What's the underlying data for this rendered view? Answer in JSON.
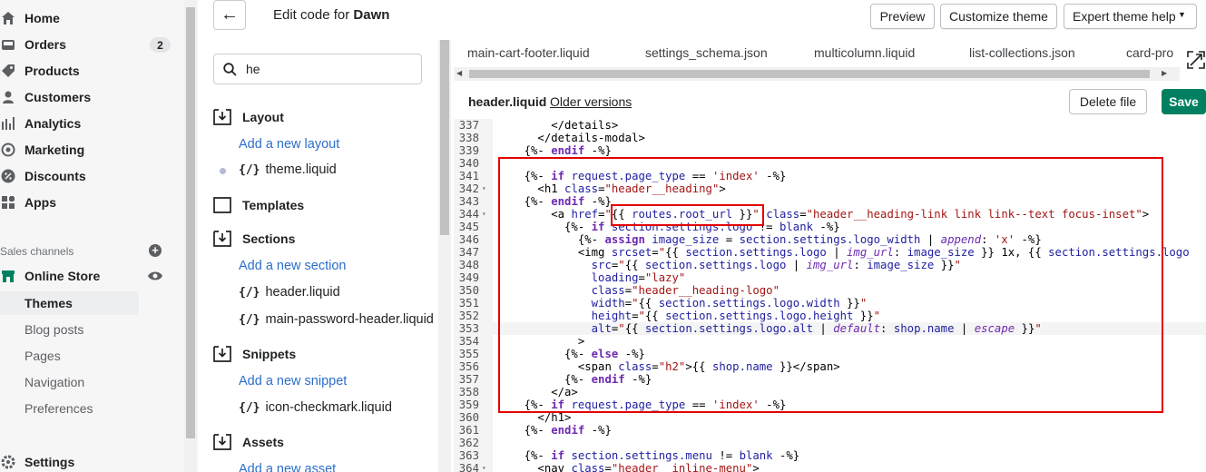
{
  "nav": {
    "items": [
      {
        "label": "Home",
        "icon": "home-icon"
      },
      {
        "label": "Orders",
        "icon": "orders-icon",
        "badge": "2"
      },
      {
        "label": "Products",
        "icon": "tag-icon"
      },
      {
        "label": "Customers",
        "icon": "person-icon"
      },
      {
        "label": "Analytics",
        "icon": "bar-chart-icon"
      },
      {
        "label": "Marketing",
        "icon": "target-icon"
      },
      {
        "label": "Discounts",
        "icon": "discount-icon"
      },
      {
        "label": "Apps",
        "icon": "apps-icon"
      }
    ],
    "sales_channels_label": "Sales channels",
    "online_store_label": "Online Store",
    "sub_items": [
      "Themes",
      "Blog posts",
      "Pages",
      "Navigation",
      "Preferences"
    ],
    "settings_label": "Settings"
  },
  "topbar": {
    "title_prefix": "Edit code for ",
    "theme_name": "Dawn",
    "preview": "Preview",
    "customize": "Customize theme",
    "expert": "Expert theme help"
  },
  "tree": {
    "search_value": "he",
    "layout_label": "Layout",
    "add_layout": "Add a new layout",
    "theme_file": "theme.liquid",
    "templates_label": "Templates",
    "sections_label": "Sections",
    "add_section": "Add a new section",
    "section_files": [
      "header.liquid",
      "main-password-header.liquid"
    ],
    "snippets_label": "Snippets",
    "add_snippet": "Add a new snippet",
    "snippet_file": "icon-checkmark.liquid",
    "assets_label": "Assets",
    "add_asset": "Add a new asset",
    "file_icon_glyph": "{/}"
  },
  "editor": {
    "tabs": [
      "main-cart-footer.liquid",
      "settings_schema.json",
      "multicolumn.liquid",
      "list-collections.json",
      "card-pro"
    ],
    "file_name": "header.liquid",
    "older_versions": "Older versions",
    "delete": "Delete file",
    "save": "Save"
  },
  "code_lines": [
    {
      "n": "337",
      "fold": "",
      "h": "        &lt;/details&gt;"
    },
    {
      "n": "338",
      "fold": "",
      "h": "      &lt;/details-modal&gt;"
    },
    {
      "n": "339",
      "fold": "",
      "h": "    {%- <span class=\"kw\">endif</span> -%}"
    },
    {
      "n": "340",
      "fold": "",
      "h": ""
    },
    {
      "n": "341",
      "fold": "",
      "h": "    {%- <span class=\"kw\">if</span> <span class=\"var\">request.page_type</span> == <span class=\"str\">'index'</span> -%}"
    },
    {
      "n": "342",
      "fold": "▾",
      "h": "      &lt;h1 <span class=\"tag\">class</span>=<span class=\"str\">\"header__heading\"</span>&gt;"
    },
    {
      "n": "343",
      "fold": "",
      "h": "    {%- <span class=\"kw\">endif</span> -%}"
    },
    {
      "n": "344",
      "fold": "▾",
      "h": "        &lt;a <span class=\"tag\">href</span>=<span class=\"str\">\"</span>{{ <span class=\"var\">routes.root_url</span> }}<span class=\"str\">\"</span> <span class=\"tag\">class</span>=<span class=\"str\">\"header__heading-link link link--text focus-inset\"</span>&gt;"
    },
    {
      "n": "345",
      "fold": "",
      "h": "          {%- <span class=\"kw\">if</span> <span class=\"var\">section.settings.logo</span> != <span class=\"var\">blank</span> -%}"
    },
    {
      "n": "346",
      "fold": "",
      "h": "            {%- <span class=\"kw\">assign</span> <span class=\"var\">image_size</span> = <span class=\"var\">section.settings.logo_width</span> | <span class=\"flt\">append</span>: <span class=\"str\">'x'</span> -%}"
    },
    {
      "n": "347",
      "fold": "",
      "h": "            &lt;img <span class=\"tag\">srcset</span>=<span class=\"str\">\"</span>{{ <span class=\"var\">section.settings.logo</span> | <span class=\"flt\">img_url</span>: <span class=\"var\">image_size</span> }} 1x, {{ <span class=\"var\">section.settings.logo</span>"
    },
    {
      "n": "348",
      "fold": "",
      "h": "              <span class=\"tag\">src</span>=<span class=\"str\">\"</span>{{ <span class=\"var\">section.settings.logo</span> | <span class=\"flt\">img_url</span>: <span class=\"var\">image_size</span> }}<span class=\"str\">\"</span>"
    },
    {
      "n": "349",
      "fold": "",
      "h": "              <span class=\"tag\">loading</span>=<span class=\"str\">\"lazy\"</span>"
    },
    {
      "n": "350",
      "fold": "",
      "h": "              <span class=\"tag\">class</span>=<span class=\"str\">\"header__heading-logo\"</span>"
    },
    {
      "n": "351",
      "fold": "",
      "h": "              <span class=\"tag\">width</span>=<span class=\"str\">\"</span>{{ <span class=\"var\">section.settings.logo.width</span> }}<span class=\"str\">\"</span>"
    },
    {
      "n": "352",
      "fold": "",
      "h": "              <span class=\"tag\">height</span>=<span class=\"str\">\"</span>{{ <span class=\"var\">section.settings.logo.height</span> }}<span class=\"str\">\"</span>"
    },
    {
      "n": "353",
      "fold": "",
      "h": "              <span class=\"tag\">alt</span>=<span class=\"str\">\"</span>{{ <span class=\"var\">section.settings.logo.alt</span> | <span class=\"flt\">default</span>: <span class=\"var\">shop.name</span> | <span class=\"flt\">escape</span> }}<span class=\"str\">\"</span>"
    },
    {
      "n": "354",
      "fold": "",
      "h": "            &gt;"
    },
    {
      "n": "355",
      "fold": "",
      "h": "          {%- <span class=\"kw\">else</span> -%}"
    },
    {
      "n": "356",
      "fold": "",
      "h": "            &lt;span <span class=\"tag\">class</span>=<span class=\"str\">\"h2\"</span>&gt;{{ <span class=\"var\">shop.name</span> }}&lt;/span&gt;"
    },
    {
      "n": "357",
      "fold": "",
      "h": "          {%- <span class=\"kw\">endif</span> -%}"
    },
    {
      "n": "358",
      "fold": "",
      "h": "        &lt;/a&gt;"
    },
    {
      "n": "359",
      "fold": "",
      "h": "    {%- <span class=\"kw\">if</span> <span class=\"var\">request.page_type</span> == <span class=\"str\">'index'</span> -%}"
    },
    {
      "n": "360",
      "fold": "",
      "h": "      &lt;/h1&gt;"
    },
    {
      "n": "361",
      "fold": "",
      "h": "    {%- <span class=\"kw\">endif</span> -%}"
    },
    {
      "n": "362",
      "fold": "",
      "h": ""
    },
    {
      "n": "363",
      "fold": "",
      "h": "    {%- <span class=\"kw\">if</span> <span class=\"var\">section.settings.menu</span> != <span class=\"var\">blank</span> -%}"
    },
    {
      "n": "364",
      "fold": "▾",
      "h": "      &lt;nav <span class=\"tag\">class</span>=<span class=\"str\">\"header__inline-menu\"</span>&gt;"
    }
  ]
}
